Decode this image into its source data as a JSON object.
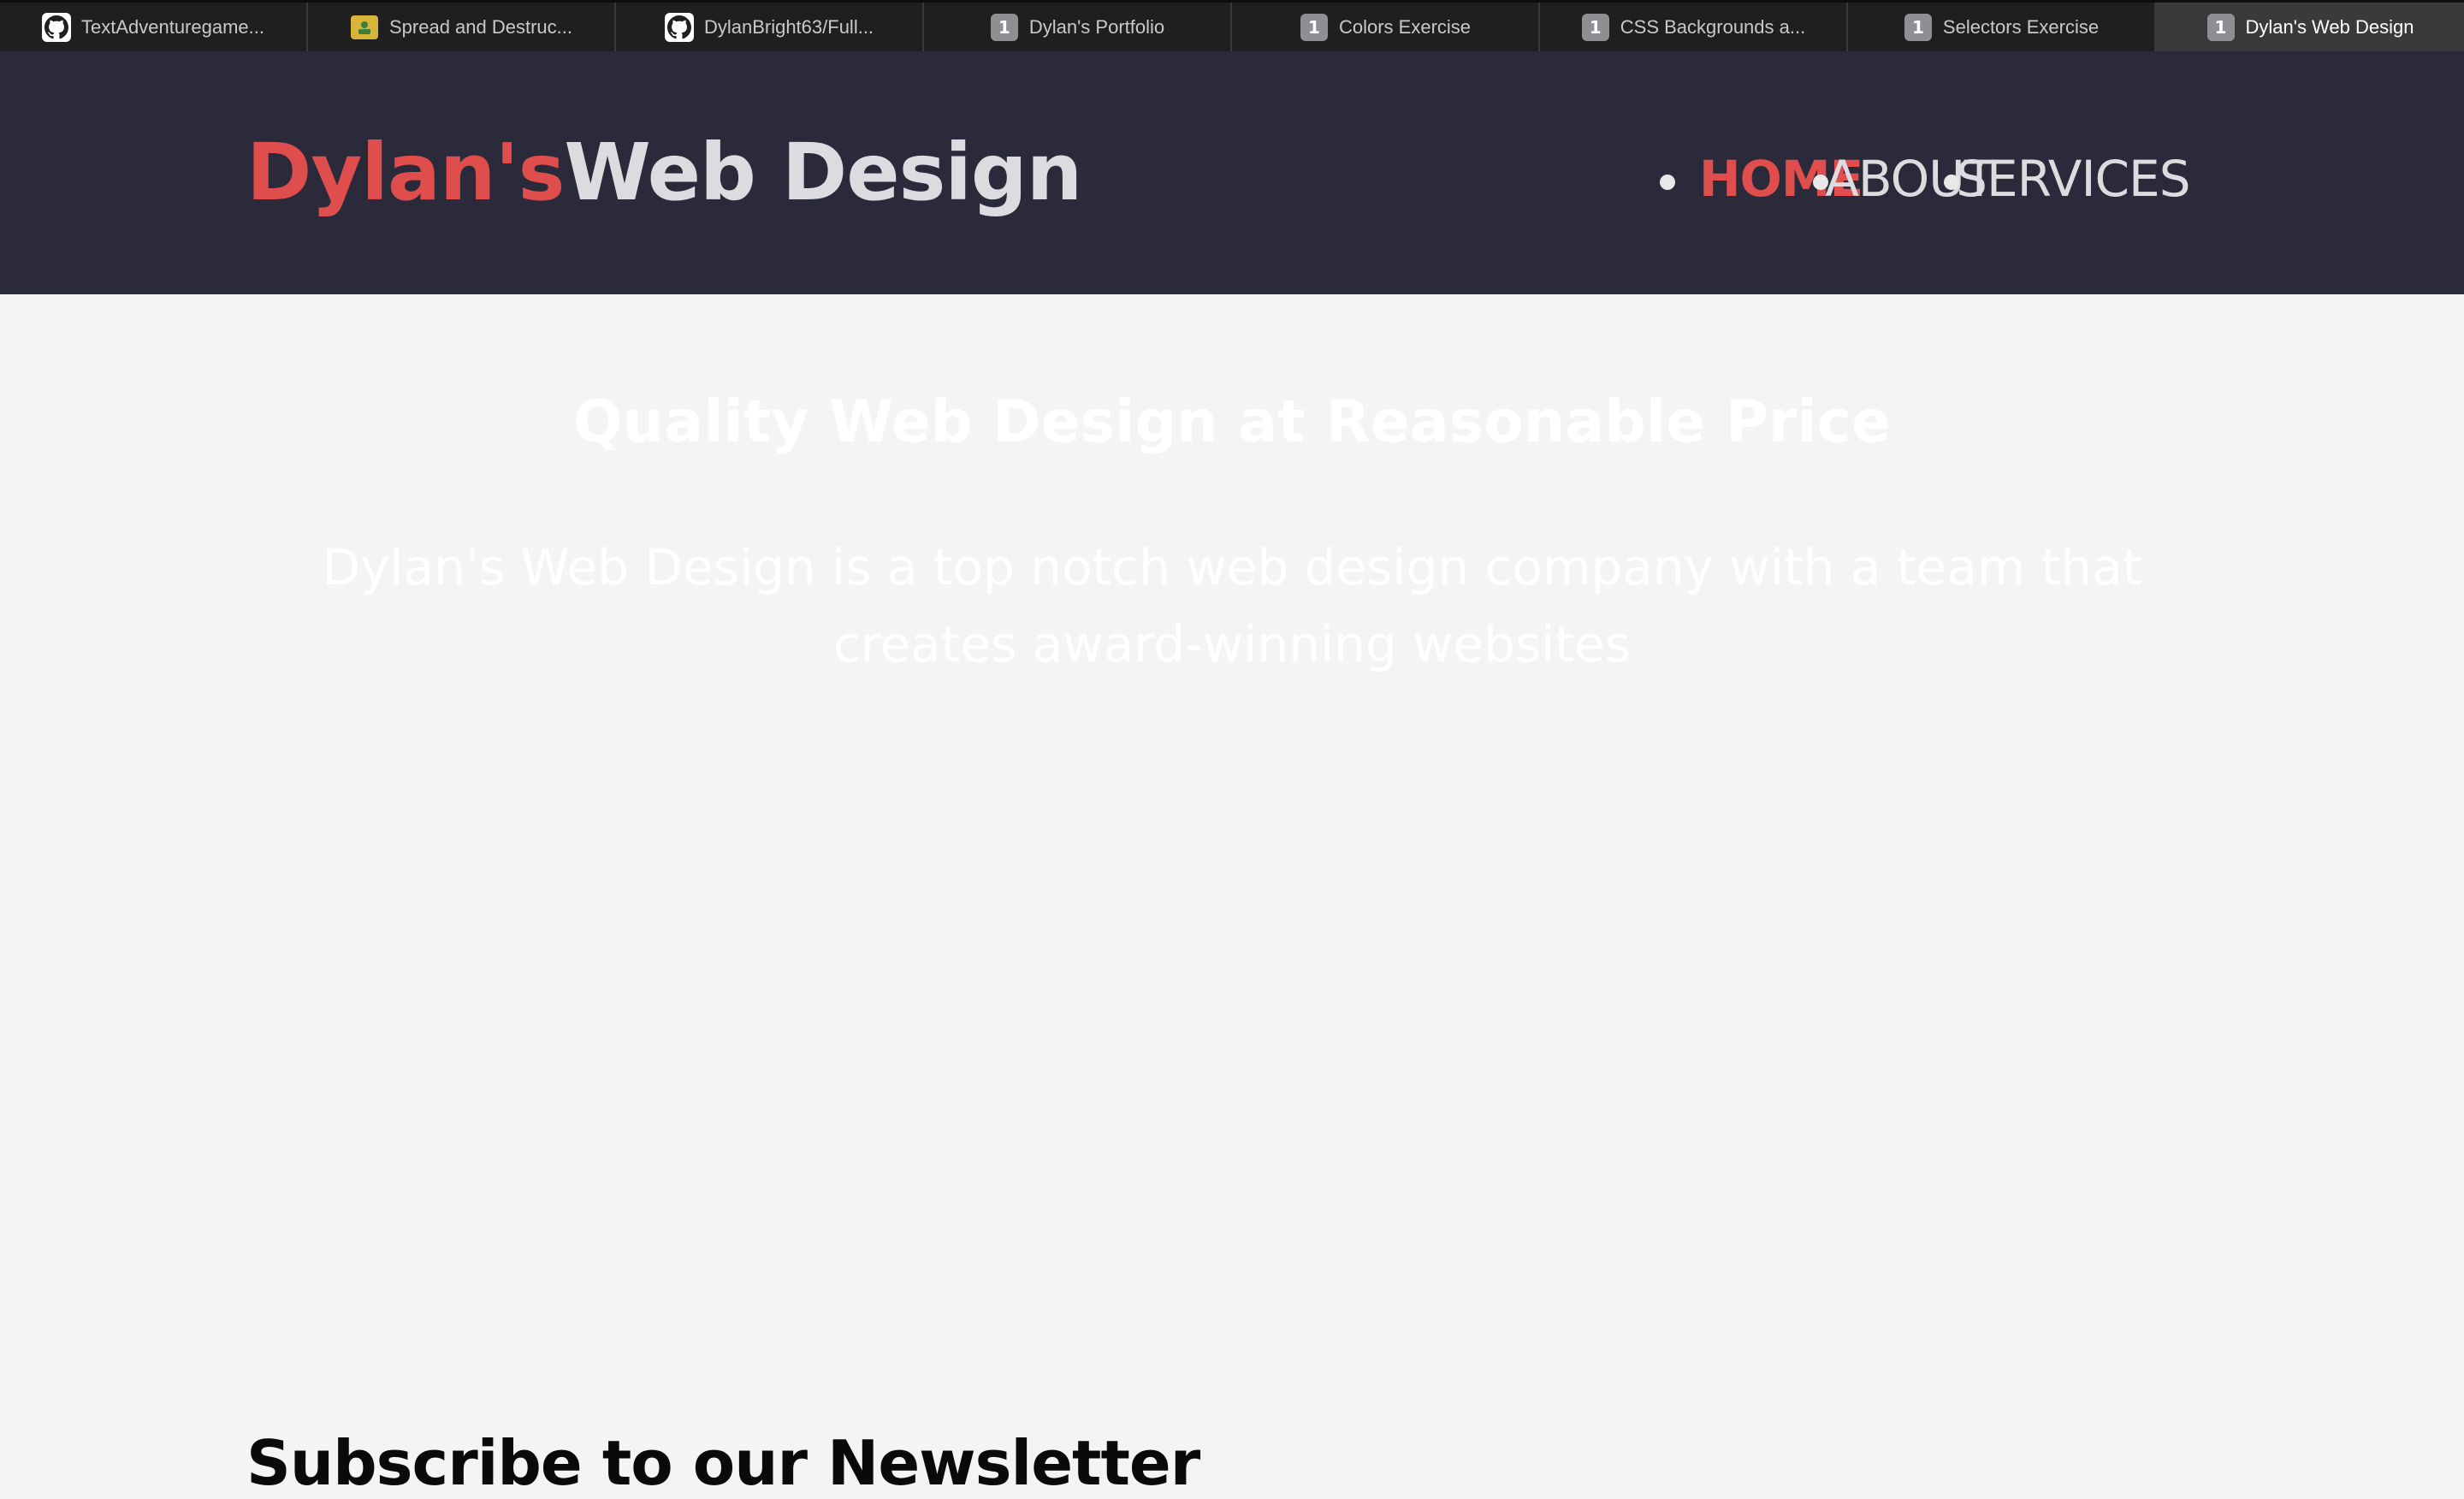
{
  "browser": {
    "tabs": [
      {
        "label": "TextAdventuregame...",
        "icon": "github-icon"
      },
      {
        "label": "Spread and Destruc...",
        "icon": "photo-icon"
      },
      {
        "label": "DylanBright63/Full...",
        "icon": "github-icon"
      },
      {
        "label": "Dylan's Portfolio",
        "icon": "badge-1-icon",
        "badge": "1"
      },
      {
        "label": "Colors Exercise",
        "icon": "badge-1-icon",
        "badge": "1"
      },
      {
        "label": "CSS Backgrounds a...",
        "icon": "badge-1-icon",
        "badge": "1"
      },
      {
        "label": "Selectors Exercise",
        "icon": "badge-1-icon",
        "badge": "1"
      },
      {
        "label": "Dylan's Web Design",
        "icon": "badge-1-icon",
        "badge": "1",
        "active": true
      }
    ]
  },
  "site": {
    "logo": {
      "part1": "Dylan's",
      "part2": "Web Design"
    },
    "nav": {
      "home": "HOME",
      "about": "ABOUT",
      "services": "SERVICES"
    },
    "hero": {
      "title": "Quality Web Design at Reasonable Price",
      "description": "Dylan's Web Design is a top notch web design company with a team that creates award-winning websites"
    },
    "newsletter": {
      "title": "Subscribe to our Newsletter"
    }
  },
  "colors": {
    "header_bg": "#2b2a3a",
    "accent_red": "#df4d4d",
    "page_bg": "#f4f4f4",
    "tab_bar_bg": "#1f1f1f"
  }
}
